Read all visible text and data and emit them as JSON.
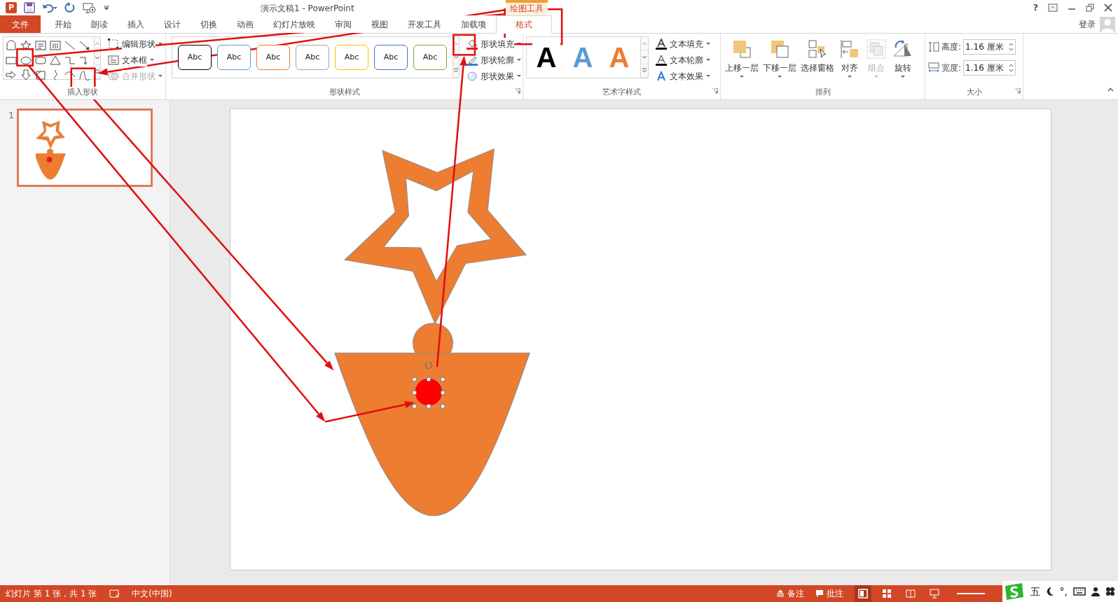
{
  "window": {
    "app_icon_letter": "P",
    "help": "?",
    "title": "演示文稿1 - PowerPoint",
    "context_label": "绘图工具"
  },
  "tabs": [
    {
      "label": "文件",
      "kind": "file",
      "selected": false
    },
    {
      "label": "开始",
      "kind": "tab",
      "selected": false
    },
    {
      "label": "朗读",
      "kind": "tab",
      "selected": false
    },
    {
      "label": "插入",
      "kind": "tab",
      "selected": false
    },
    {
      "label": "设计",
      "kind": "tab",
      "selected": false
    },
    {
      "label": "切换",
      "kind": "tab",
      "selected": false
    },
    {
      "label": "动画",
      "kind": "tab",
      "selected": false
    },
    {
      "label": "幻灯片放映",
      "kind": "tab",
      "selected": false
    },
    {
      "label": "审阅",
      "kind": "tab",
      "selected": false
    },
    {
      "label": "视图",
      "kind": "tab",
      "selected": false
    },
    {
      "label": "开发工具",
      "kind": "tab",
      "selected": false
    },
    {
      "label": "加载项",
      "kind": "tab",
      "selected": false
    },
    {
      "label": "格式",
      "kind": "context",
      "selected": true
    }
  ],
  "account": {
    "label": "登录"
  },
  "insert_shapes": {
    "title": "插入形状",
    "commands": [
      {
        "label": "编辑形状",
        "kind": "edit",
        "disabled": false
      },
      {
        "label": "文本框",
        "kind": "textbox",
        "disabled": false
      },
      {
        "label": "合并形状",
        "kind": "merge",
        "disabled": true
      }
    ]
  },
  "shape_styles": {
    "title": "形状样式",
    "swatches": [
      {
        "label": "Abc",
        "color": "#000000"
      },
      {
        "label": "Abc",
        "color": "#5b9bd5"
      },
      {
        "label": "Abc",
        "color": "#ed7d31"
      },
      {
        "label": "Abc",
        "color": "#a5a5a5"
      },
      {
        "label": "Abc",
        "color": "#ffc000"
      },
      {
        "label": "Abc",
        "color": "#4472c4"
      },
      {
        "label": "Abc",
        "color": "#70ad47"
      }
    ],
    "commands": [
      {
        "label": "形状填充",
        "kind": "fill"
      },
      {
        "label": "形状轮廓",
        "kind": "outline"
      },
      {
        "label": "形状效果",
        "kind": "effect"
      }
    ]
  },
  "wordart_styles": {
    "title": "艺术字样式",
    "samples": [
      {
        "label": "A",
        "color": "#000000"
      },
      {
        "label": "A",
        "color": "#5b9bd5"
      },
      {
        "label": "A",
        "color": "#ed7d31"
      }
    ],
    "commands": [
      {
        "label": "文本填充",
        "kind": "fill"
      },
      {
        "label": "文本轮廓",
        "kind": "outline"
      },
      {
        "label": "文本效果",
        "kind": "effect"
      }
    ]
  },
  "arrange": {
    "title": "排列",
    "commands": [
      {
        "label": "上移一层",
        "kind": "forward",
        "disabled": false
      },
      {
        "label": "下移一层",
        "kind": "backward",
        "disabled": false
      },
      {
        "label": "选择窗格",
        "kind": "pane",
        "disabled": false
      },
      {
        "label": "对齐",
        "kind": "align",
        "disabled": false
      },
      {
        "label": "组合",
        "kind": "group",
        "disabled": true
      },
      {
        "label": "旋转",
        "kind": "rotate",
        "disabled": false
      }
    ]
  },
  "size": {
    "title": "大小",
    "fields": [
      {
        "label": "高度:",
        "kind": "height",
        "value": "1.16 厘米"
      },
      {
        "label": "宽度:",
        "kind": "width",
        "value": "1.16 厘米"
      }
    ]
  },
  "thumbnails": [
    {
      "number": "1",
      "selected": true
    }
  ],
  "status_bar": {
    "slide_info": "幻灯片 第 1 张，共 1 张",
    "language": "中文(中国)",
    "notes": "备注",
    "comments": "批注",
    "views": [
      {
        "kind": "normal",
        "selected": true
      },
      {
        "kind": "sorter",
        "selected": false
      },
      {
        "kind": "reading",
        "selected": false
      },
      {
        "kind": "slideshow",
        "selected": false
      }
    ]
  },
  "ime_toolbar": {
    "mode": "五",
    "punctuation": "°,"
  }
}
